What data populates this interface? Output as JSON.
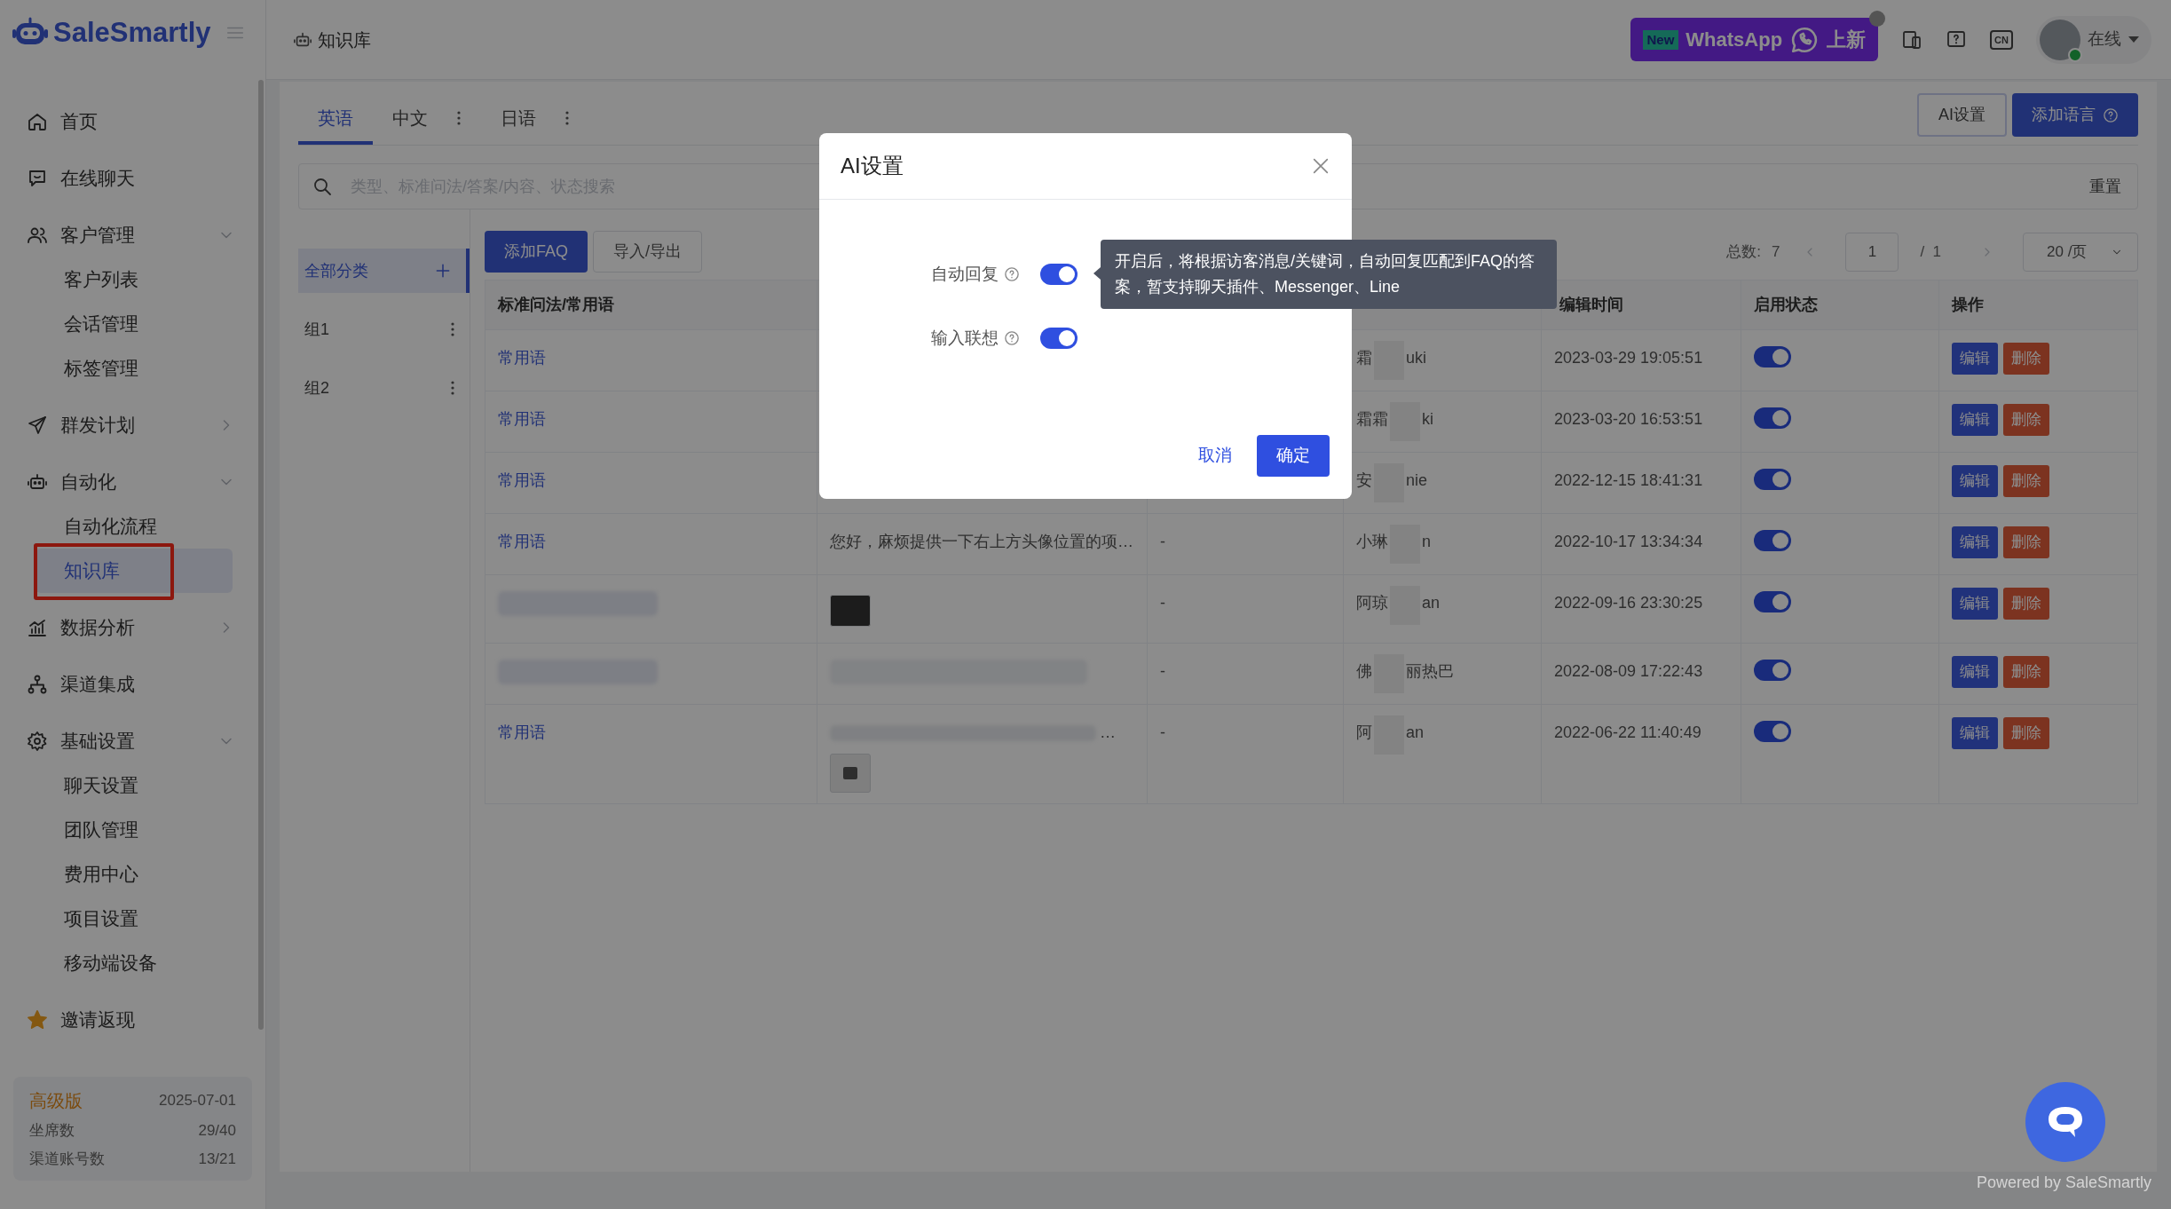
{
  "app": {
    "logo": "SaleSmartly"
  },
  "sidebar": {
    "items": [
      {
        "label": "首页",
        "kind": "link",
        "selected": false
      },
      {
        "label": "在线聊天",
        "kind": "link",
        "selected": false
      },
      {
        "label": "客户管理",
        "kind": "group",
        "expanded": true,
        "selected": false,
        "children": [
          {
            "label": "客户列表",
            "selected": false,
            "highlighted": false
          },
          {
            "label": "会话管理",
            "selected": false,
            "highlighted": false
          },
          {
            "label": "标签管理",
            "selected": false,
            "highlighted": false
          }
        ]
      },
      {
        "label": "群发计划",
        "kind": "group",
        "expanded": false,
        "selected": false
      },
      {
        "label": "自动化",
        "kind": "group",
        "expanded": true,
        "selected": false,
        "children": [
          {
            "label": "自动化流程",
            "selected": false,
            "highlighted": false
          },
          {
            "label": "知识库",
            "selected": true,
            "highlighted": true
          }
        ]
      },
      {
        "label": "数据分析",
        "kind": "group",
        "expanded": false,
        "selected": false
      },
      {
        "label": "渠道集成",
        "kind": "link",
        "selected": false
      },
      {
        "label": "基础设置",
        "kind": "group",
        "expanded": true,
        "selected": false,
        "children": [
          {
            "label": "聊天设置",
            "selected": false,
            "highlighted": false
          },
          {
            "label": "团队管理",
            "selected": false,
            "highlighted": false
          },
          {
            "label": "费用中心",
            "selected": false,
            "highlighted": false
          },
          {
            "label": "项目设置",
            "selected": false,
            "highlighted": false
          },
          {
            "label": "移动端设备",
            "selected": false,
            "highlighted": false
          }
        ]
      },
      {
        "label": "邀请返现",
        "kind": "link",
        "selected": false
      }
    ],
    "plan": {
      "name": "高级版",
      "expiry": "2025-07-01",
      "stats": [
        {
          "label": "坐席数",
          "value": "29/40"
        },
        {
          "label": "渠道账号数",
          "value": "13/21"
        }
      ]
    }
  },
  "topbar": {
    "breadcrumb": "知识库",
    "banner": {
      "badge": "New",
      "label": "WhatsApp",
      "suffix": "上新"
    },
    "language": "CN"
  },
  "user": {
    "status": "在线",
    "online": true
  },
  "tabs": [
    {
      "label": "英语",
      "selected": true,
      "has_menu": false
    },
    {
      "label": "中文",
      "selected": false,
      "has_menu": true
    },
    {
      "label": "日语",
      "selected": false,
      "has_menu": true
    }
  ],
  "header_buttons": [
    {
      "label": "AI设置",
      "kind": "outline"
    },
    {
      "label": "添加语言",
      "kind": "primary"
    }
  ],
  "search": {
    "placeholder": "类型、标准问法/答案/内容、状态搜索",
    "reset": "重置"
  },
  "categories": [
    {
      "label": "全部分类",
      "kind": "all",
      "selected": true
    },
    {
      "label": "组1",
      "kind": "group",
      "selected": false
    },
    {
      "label": "组2",
      "kind": "group",
      "selected": false
    }
  ],
  "toolbar": [
    {
      "label": "添加FAQ",
      "kind": "primary"
    },
    {
      "label": "导入/导出",
      "kind": "outline"
    }
  ],
  "pagination": {
    "total_label": "总数:",
    "total": "7",
    "page": "1",
    "pages": "/  1",
    "page_size": "20 /页"
  },
  "table": {
    "columns": {
      "question": "标准问法/常用语",
      "edited": "编辑时间",
      "status": "启用状态",
      "actions": "操作"
    },
    "rows": [
      {
        "question": {
          "kind": "text",
          "text": "常用语"
        },
        "user_start": "霜",
        "user_end": "uki",
        "edited": "2023-03-29 19:05:51",
        "enabled": true,
        "actions": [
          "编辑",
          "删除"
        ]
      },
      {
        "question": {
          "kind": "text",
          "text": "常用语"
        },
        "user_start": "霜霜",
        "user_end": "ki",
        "edited": "2023-03-20 16:53:51",
        "enabled": true,
        "actions": [
          "编辑",
          "删除"
        ]
      },
      {
        "question": {
          "kind": "text",
          "text": "常用语"
        },
        "user_start": "安",
        "user_end": "nie",
        "edited": "2022-12-15 18:41:31",
        "enabled": true,
        "actions": [
          "编辑",
          "删除"
        ]
      },
      {
        "question": {
          "kind": "text",
          "text": "常用语"
        },
        "answer": {
          "kind": "text",
          "text": "您好，麻烦提供一下右上方头像位置的项…"
        },
        "extra": "-",
        "user_start": "小琳",
        "user_end": "n",
        "edited": "2022-10-17 13:34:34",
        "enabled": true,
        "actions": [
          "编辑",
          "删除"
        ]
      },
      {
        "question": {
          "kind": "blurred"
        },
        "answer": {
          "kind": "image"
        },
        "extra": "-",
        "user_start": "阿琼",
        "user_end": "an",
        "edited": "2022-09-16 23:30:25",
        "enabled": true,
        "actions": [
          "编辑",
          "删除"
        ]
      },
      {
        "question": {
          "kind": "blurred"
        },
        "answer": {
          "kind": "blurred"
        },
        "extra": "-",
        "user_start": "佛",
        "user_end": "丽热巴",
        "edited": "2022-08-09 17:22:43",
        "enabled": true,
        "actions": [
          "编辑",
          "删除"
        ]
      },
      {
        "question": {
          "kind": "text",
          "text": "常用语"
        },
        "answer": {
          "kind": "blurred_image",
          "text": "…"
        },
        "extra": "-",
        "user_start": "阿",
        "user_end": "an",
        "edited": "2022-06-22 11:40:49",
        "enabled": true,
        "actions": [
          "编辑",
          "删除"
        ]
      }
    ]
  },
  "modal": {
    "title": "AI设置",
    "settings": [
      {
        "label": "自动回复",
        "on": true
      },
      {
        "label": "输入联想",
        "on": true
      }
    ],
    "tooltip": "开启后，将根据访客消息/关键词，自动回复匹配到FAQ的答案，暂支持聊天插件、Messenger、Line",
    "cancel": "取消",
    "confirm": "确定"
  },
  "footer": "Powered by SaleSmartly"
}
